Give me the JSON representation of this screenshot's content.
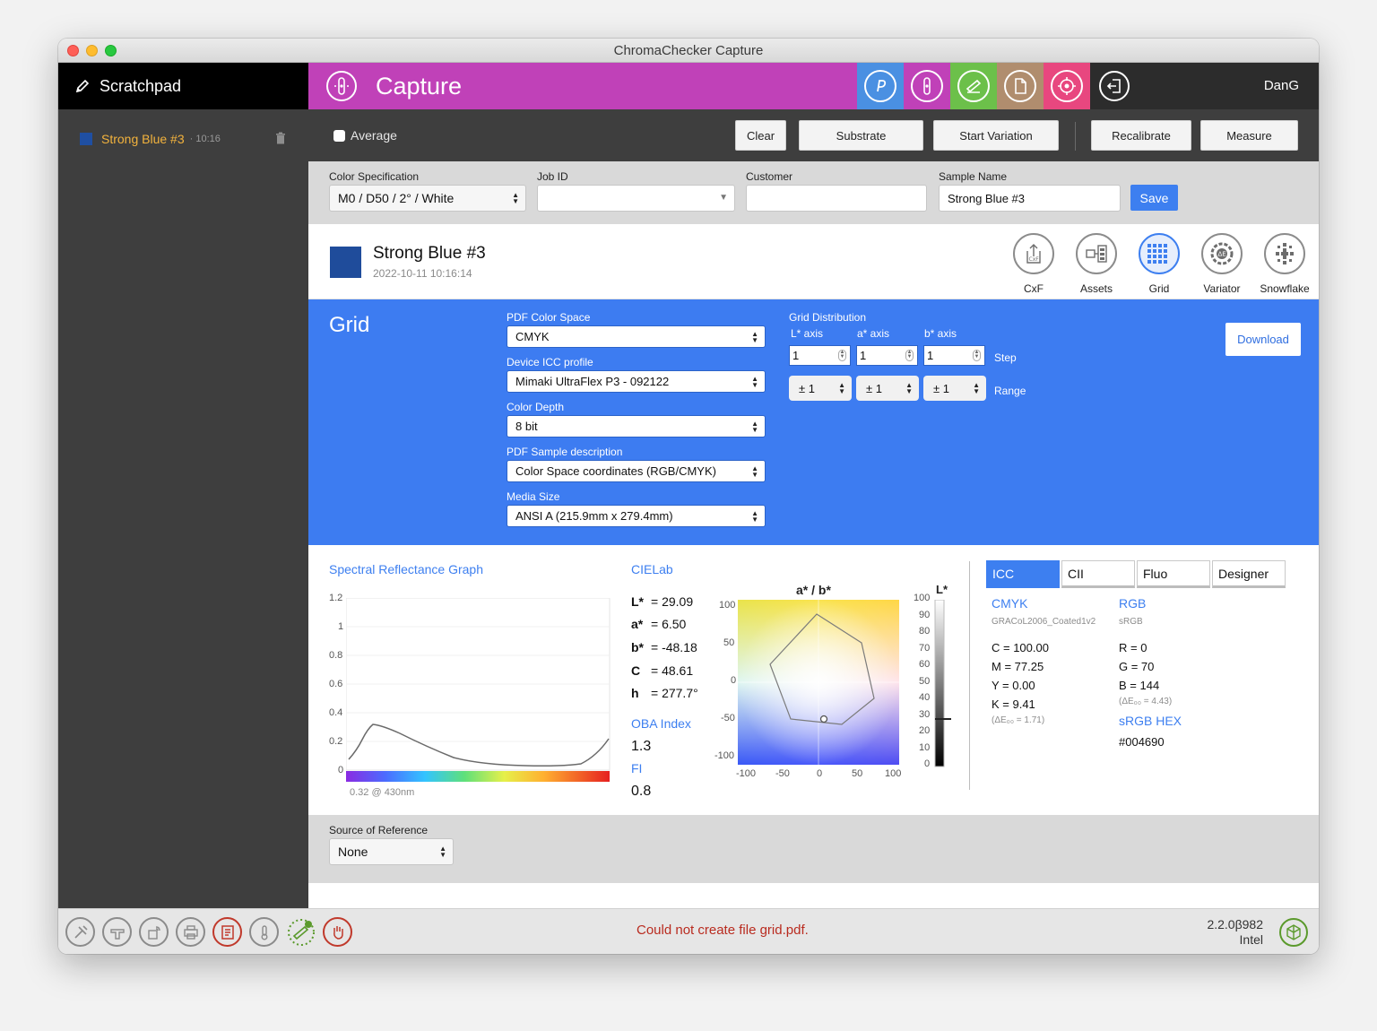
{
  "window": {
    "title": "ChromaChecker Capture"
  },
  "sidebar": {
    "header": "Scratchpad",
    "items": [
      {
        "name": "Strong Blue #3",
        "time": "· 10:16",
        "swatch": "#1f4fa2"
      }
    ]
  },
  "topbar": {
    "title": "Capture",
    "accent": "#c041b8",
    "modes": [
      {
        "icon": "p-icon",
        "color": "#4a90e2"
      },
      {
        "icon": "capture-icon",
        "color": "#c041b8"
      },
      {
        "icon": "scan-icon",
        "color": "#6cc04a"
      },
      {
        "icon": "document-icon",
        "color": "#b08d6e"
      },
      {
        "icon": "target-icon",
        "color": "#e8477f"
      }
    ],
    "user": "DanG"
  },
  "toolbar": {
    "average_label": "Average",
    "buttons": [
      "Clear",
      "Substrate",
      "Start Variation",
      "Recalibrate",
      "Measure"
    ]
  },
  "fields": {
    "color_spec": {
      "label": "Color Specification",
      "value": "M0 / D50 / 2° / White"
    },
    "job_id": {
      "label": "Job ID",
      "value": ""
    },
    "customer": {
      "label": "Customer",
      "value": ""
    },
    "sample_name": {
      "label": "Sample Name",
      "value": "Strong Blue #3"
    },
    "save_label": "Save"
  },
  "sample": {
    "name": "Strong Blue #3",
    "date": "2022-10-11 10:16:14",
    "swatch": "#1f4c9b",
    "tools": [
      "CxF",
      "Assets",
      "Grid",
      "Variator",
      "Snowflake"
    ]
  },
  "grid": {
    "title": "Grid",
    "pdf_color_space": {
      "label": "PDF Color Space",
      "value": "CMYK"
    },
    "device_icc": {
      "label": "Device ICC profile",
      "value": "Mimaki UltraFlex P3 - 092122"
    },
    "color_depth": {
      "label": "Color Depth",
      "value": "8 bit"
    },
    "pdf_sample_desc": {
      "label": "PDF Sample description",
      "value": "Color Space coordinates (RGB/CMYK)"
    },
    "media_size": {
      "label": "Media Size",
      "value": "ANSI A (215.9mm x 279.4mm)"
    },
    "distribution": {
      "label": "Grid Distribution",
      "axes": [
        "L* axis",
        "a* axis",
        "b* axis"
      ],
      "steps": [
        "1",
        "1",
        "1"
      ],
      "ranges": [
        "± 1",
        "± 1",
        "± 1"
      ],
      "step_label": "Step",
      "range_label": "Range"
    },
    "download_label": "Download"
  },
  "spectral": {
    "title": "Spectral Reflectance Graph",
    "y_ticks": [
      "1.2",
      "1",
      "0.8",
      "0.6",
      "0.4",
      "0.2",
      "0"
    ],
    "footer": "0.32 @ 430nm"
  },
  "cielab": {
    "title": "CIELab",
    "rows": [
      {
        "k": "L*",
        "v": "= 29.09"
      },
      {
        "k": "a*",
        "v": "= 6.50"
      },
      {
        "k": "b*",
        "v": "= -48.18"
      },
      {
        "k": "C",
        "v": "= 48.61"
      },
      {
        "k": "h",
        "v": "= 277.7°"
      }
    ],
    "oba_title": "OBA Index",
    "oba_value": "1.3",
    "fi_title": "FI",
    "fi_value": "0.8"
  },
  "ab_plot": {
    "title": "a* / b*",
    "y_ticks": [
      "100",
      "50",
      "0",
      "-50",
      "-100"
    ],
    "x_ticks": [
      "-100",
      "-50",
      "0",
      "50",
      "100"
    ],
    "l_title": "L*",
    "l_ticks": [
      "100",
      "90",
      "80",
      "70",
      "60",
      "50",
      "40",
      "30",
      "20",
      "10",
      "0"
    ]
  },
  "icc": {
    "tabs": [
      "ICC",
      "CII",
      "Fluo",
      "Designer"
    ],
    "cmyk_title": "CMYK",
    "cmyk_profile": "GRACoL2006_Coated1v2",
    "cmyk": [
      "C = 100.00",
      "M = 77.25",
      "Y = 0.00",
      "K = 9.41"
    ],
    "cmyk_de": "(ΔE₀₀ = 1.71)",
    "rgb_title": "RGB",
    "rgb_profile": "sRGB",
    "rgb": [
      "R = 0",
      "G = 70",
      "B = 144"
    ],
    "rgb_de": "(ΔE₀₀ = 4.43)",
    "hex_title": "sRGB HEX",
    "hex_value": "#004690"
  },
  "reference": {
    "label": "Source of Reference",
    "value": "None"
  },
  "status": {
    "message": "Could not create file grid.pdf.",
    "version": "2.2.0β982",
    "arch": "Intel"
  }
}
